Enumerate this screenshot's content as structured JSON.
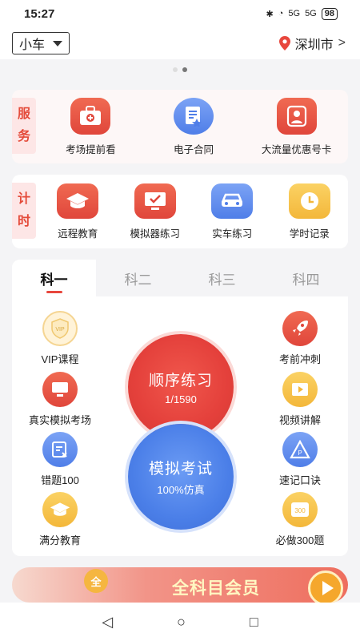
{
  "status": {
    "time": "15:27",
    "battery": "98",
    "signal1": "5G",
    "signal2": "5G"
  },
  "header": {
    "car_type": "小车",
    "city": "深圳市"
  },
  "services": {
    "tag": [
      "服",
      "务"
    ],
    "items": [
      {
        "label": "考场提前看",
        "icon": "first-aid-kit-icon"
      },
      {
        "label": "电子合同",
        "icon": "contract-icon"
      },
      {
        "label": "大流量优惠号卡",
        "icon": "sim-card-icon"
      }
    ]
  },
  "timing": {
    "tag": [
      "计",
      "时"
    ],
    "items": [
      {
        "label": "远程教育",
        "icon": "graduation-cap-icon"
      },
      {
        "label": "模拟器练习",
        "icon": "simulator-monitor-icon"
      },
      {
        "label": "实车练习",
        "icon": "car-icon"
      },
      {
        "label": "学时记录",
        "icon": "clock-icon"
      }
    ]
  },
  "subjects": {
    "tabs": [
      "科一",
      "科二",
      "科三",
      "科四"
    ],
    "active": 0,
    "left": [
      {
        "label": "VIP课程",
        "icon": "vip-icon"
      },
      {
        "label": "真实模拟考场",
        "icon": "exam-monitor-icon"
      },
      {
        "label": "错题100",
        "icon": "wrong-questions-icon"
      },
      {
        "label": "满分教育",
        "icon": "graduation-cap-icon"
      }
    ],
    "right": [
      {
        "label": "考前冲刺",
        "icon": "rocket-icon"
      },
      {
        "label": "视频讲解",
        "icon": "video-icon"
      },
      {
        "label": "速记口诀",
        "icon": "mnemonic-icon"
      },
      {
        "label": "必做300题",
        "icon": "300-questions-icon"
      }
    ],
    "practice": {
      "title": "顺序练习",
      "sub": "1/1590"
    },
    "mock": {
      "title": "模拟考试",
      "sub": "100%仿真"
    }
  },
  "banner": {
    "coin": "全",
    "text": "全科目会员"
  },
  "colors": {
    "accent": "#e8473d",
    "blue": "#4f7ee8",
    "yellow": "#f3b73a"
  }
}
